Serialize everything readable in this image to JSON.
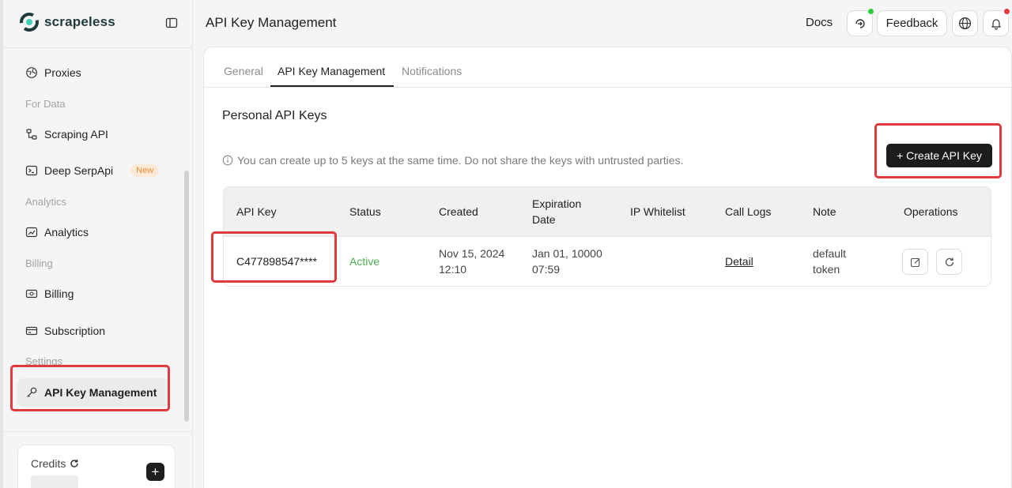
{
  "app": {
    "brand": "scrapeless"
  },
  "sidebar": {
    "items": [
      {
        "label": "Proxies",
        "icon": "globe-network-icon"
      },
      {
        "section": "For Data"
      },
      {
        "label": "Scraping API",
        "icon": "flow-icon"
      },
      {
        "label": "Deep SerpApi",
        "icon": "terminal-icon",
        "badge": "New"
      },
      {
        "section": "Analytics"
      },
      {
        "label": "Analytics",
        "icon": "chart-icon"
      },
      {
        "section": "Billing"
      },
      {
        "label": "Billing",
        "icon": "receipt-icon"
      },
      {
        "label": "Subscription",
        "icon": "card-icon"
      },
      {
        "section": "Settings"
      },
      {
        "label": "API Key Management",
        "icon": "key-icon",
        "active": true
      }
    ],
    "credits_label": "Credits"
  },
  "header": {
    "title": "API Key Management",
    "docs": "Docs",
    "feedback": "Feedback"
  },
  "tabs": [
    "General",
    "API Key Management",
    "Notifications"
  ],
  "active_tab": "API Key Management",
  "main": {
    "section_title": "Personal API Keys",
    "info_text": "You can create up to 5 keys at the same time. Do not share the keys with untrusted parties.",
    "create_button": "+ Create API Key"
  },
  "table": {
    "headers": [
      "API Key",
      "Status",
      "Created",
      "Expiration Date",
      "IP Whitelist",
      "Call Logs",
      "Note",
      "Operations"
    ],
    "header_expiration_line1": "Expiration",
    "header_expiration_line2": "Date",
    "rows": [
      {
        "api_key": "C477898547****",
        "status": "Active",
        "created_date": "Nov 15, 2024",
        "created_time": "12:10",
        "expiration_date": "Jan 01, 10000",
        "expiration_time": "07:59",
        "ip_whitelist": "",
        "call_logs": "Detail",
        "note_line1": "default",
        "note_line2": "token"
      }
    ]
  },
  "colors": {
    "status_active": "#4caf50",
    "highlight": "#e0393e",
    "brand_teal": "#1f3a3a",
    "notification_green": "#2ecc40",
    "notification_red": "#e0393e"
  }
}
